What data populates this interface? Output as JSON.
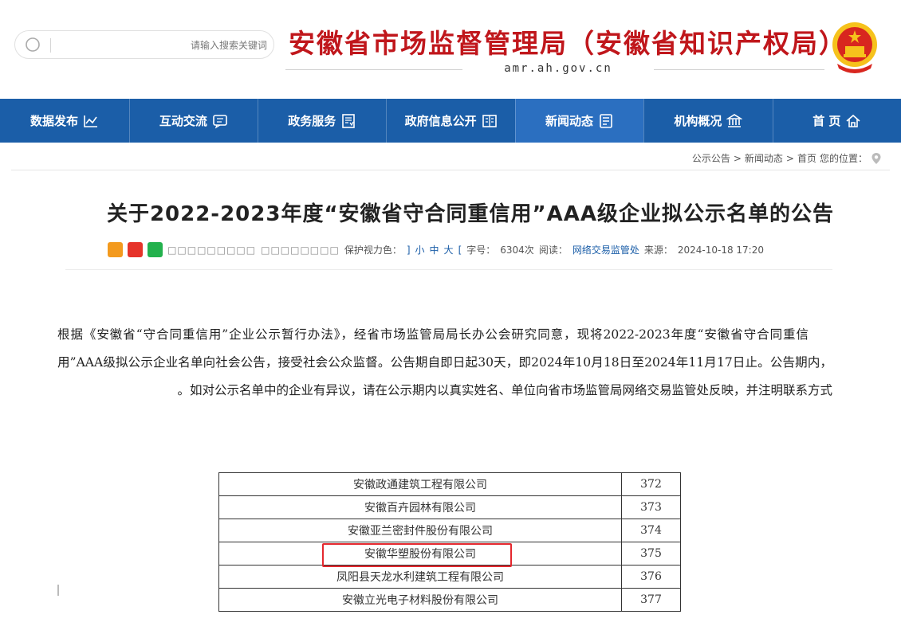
{
  "header": {
    "title": "安徽省市场监督管理局（安徽省知识产权局）",
    "url": "amr.ah.gov.cn",
    "search_placeholder": "请输入搜索关键词",
    "emblem_icon": "national-emblem-icon"
  },
  "nav": {
    "items": [
      {
        "label": "首 页",
        "icon": "home-icon"
      },
      {
        "label": "机构概况",
        "icon": "institution-icon"
      },
      {
        "label": "新闻动态",
        "icon": "news-icon"
      },
      {
        "label": "政府信息公开",
        "icon": "book-icon"
      },
      {
        "label": "政务服务",
        "icon": "service-icon"
      },
      {
        "label": "互动交流",
        "icon": "chat-icon"
      },
      {
        "label": "数据发布",
        "icon": "chart-icon"
      }
    ],
    "active_index": 2
  },
  "breadcrumb": {
    "prefix": "您的位置：",
    "home": "首页",
    "sep": ">",
    "section": "新闻动态",
    "current": "公示公告"
  },
  "article": {
    "title": "关于2022-2023年度“安徽省守合同重信用”AAA级企业拟公示名单的公告",
    "meta": {
      "date": "2024-10-18 17:20",
      "source_label": "来源：",
      "source": "网络交易监管处",
      "views_label": "阅读：",
      "views": "6304次",
      "fontsize_label": "字号：",
      "fontsize_open": "[",
      "font_large": "大",
      "font_medium": "中",
      "font_small": "小",
      "fontsize_close": "]",
      "eye_label": "保护视力色：",
      "eye_squares": "□□□□□□□□",
      "trailing_squares": "□□□□□□□□□"
    },
    "paragraph": "根据《安徽省“守合同重信用”企业公示暂行办法》，经省市场监管局局长办公会研究同意，现将2022-2023年度“安徽省守合同重信用”AAA级拟公示企业名单向社会公告，接受社会公众监督。公告期自即日起30天，即2024年10月18日至2024年11月17日止。公告期内，如对公示名单中的企业有异议，请在公示期内以真实姓名、单位向省市场监管局网络交易监管处反映，并注明联系方式。"
  },
  "table": {
    "rows": [
      {
        "num": "372",
        "name": "安徽政通建筑工程有限公司"
      },
      {
        "num": "373",
        "name": "安徽百卉园林有限公司"
      },
      {
        "num": "374",
        "name": "安徽亚兰密封件股份有限公司"
      },
      {
        "num": "375",
        "name": "安徽华塑股份有限公司"
      },
      {
        "num": "376",
        "name": "凤阳县天龙水利建筑工程有限公司"
      },
      {
        "num": "377",
        "name": "安徽立光电子材料股份有限公司"
      }
    ],
    "highlight_color": "#e4282e"
  },
  "colors": {
    "nav_bg": "#1b5ea8",
    "title_red": "#c0171c"
  }
}
